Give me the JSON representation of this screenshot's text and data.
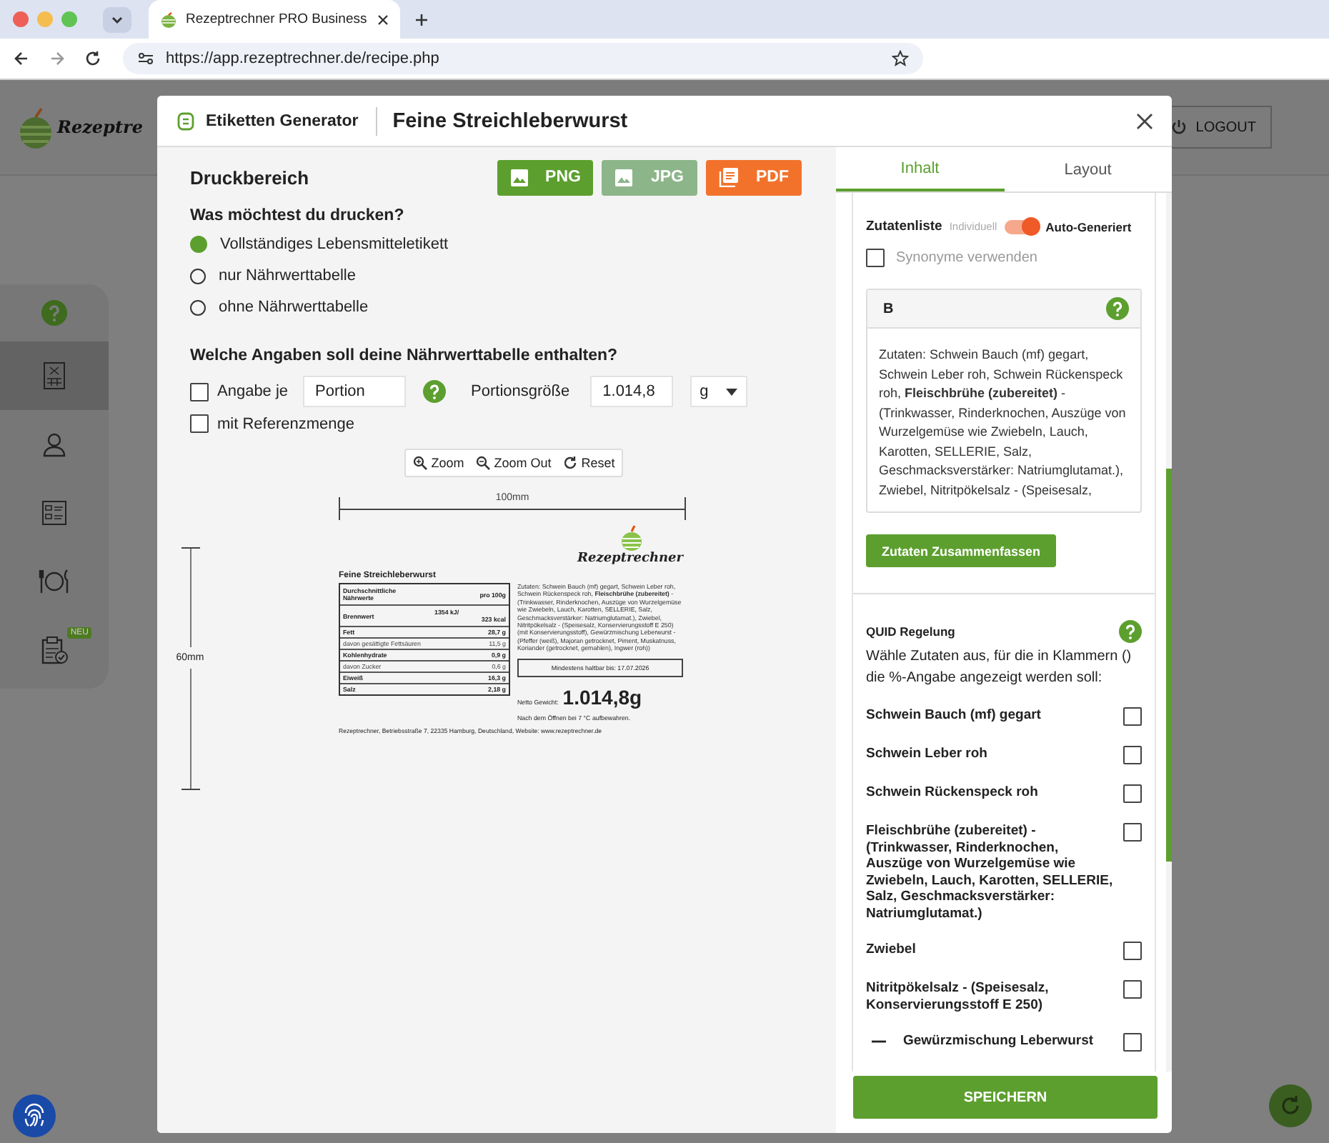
{
  "browser": {
    "tab_title": "Rezeptrechner PRO Business",
    "url": "https://app.rezeptrechner.de/recipe.php"
  },
  "app": {
    "logo_text": "Rezeptre",
    "logout": "LOGOUT",
    "sidebar": [
      {
        "kind": "help",
        "selected": false
      },
      {
        "kind": "recipe",
        "selected": true
      },
      {
        "kind": "user",
        "selected": false
      },
      {
        "kind": "checklist",
        "selected": false
      },
      {
        "kind": "dining",
        "selected": false
      },
      {
        "kind": "clipboard",
        "selected": false,
        "badge": "NEU"
      }
    ]
  },
  "modal": {
    "section": "Etiketten Generator",
    "title": "Feine Streichleberwurst",
    "left": {
      "heading": "Druckbereich",
      "export_buttons": [
        {
          "label": "PNG",
          "kind": "image",
          "color": "#5c9f2e"
        },
        {
          "label": "JPG",
          "kind": "image",
          "color": "#8db58a"
        },
        {
          "label": "PDF",
          "kind": "pdf",
          "color": "#f2722c"
        }
      ],
      "print_question": "Was möchtest du drucken?",
      "print_options": [
        {
          "label": "Vollständiges Lebensmitteletikett",
          "selected": true
        },
        {
          "label": "nur Nährwerttabelle",
          "selected": false
        },
        {
          "label": "ohne Nährwerttabelle",
          "selected": false
        }
      ],
      "table_question": "Welche Angaben soll deine Nährwerttabelle enthalten?",
      "per_unit": {
        "label": "Angabe je",
        "checked": false,
        "value": "Portion"
      },
      "portion_size": {
        "label": "Portionsgröße",
        "value": "1.014,8",
        "unit": "g"
      },
      "reference": {
        "label": "mit Referenzmenge",
        "checked": false
      },
      "zoom_buttons": [
        {
          "label": "Zoom",
          "kind": "zoom-in"
        },
        {
          "label": "Zoom Out",
          "kind": "zoom-out"
        },
        {
          "label": "Reset",
          "kind": "reset"
        }
      ],
      "preview": {
        "width_label": "100mm",
        "height_label": "60mm",
        "product_name": "Feine Streichleberwurst",
        "logo_text": "Rezeptrechner",
        "table_head": [
          "Durchschnittliche Nährwerte",
          "pro 100g"
        ],
        "energy": {
          "name": "Brennwert",
          "values": [
            "1354 kJ/",
            "323 kcal"
          ]
        },
        "rows": [
          {
            "name": "Fett",
            "value": "28,7 g",
            "kind": "main"
          },
          {
            "name": "davon gesättigte Fettsäuren",
            "value": "11,5 g",
            "kind": "sub"
          },
          {
            "name": "Kohlenhydrate",
            "value": "0,9 g",
            "kind": "main"
          },
          {
            "name": "davon Zucker",
            "value": "0,6 g",
            "kind": "sub"
          },
          {
            "name": "Eiweiß",
            "value": "16,3 g",
            "kind": "main"
          },
          {
            "name": "Salz",
            "value": "2,18 g",
            "kind": "main"
          }
        ],
        "ingredients": "Zutaten: Schwein Bauch (mf) gegart, Schwein Leber roh, Schwein Rückenspeck roh, **Fleischbrühe (zubereitet)** - (Trinkwasser, Rinderknochen, Auszüge von Wurzelgemüse wie Zwiebeln, Lauch, Karotten,  SELLERIE, Salz, Geschmacksverstärker: Natriumglutamat.), Zwiebel, Nitritpökelsalz - (Speisesalz, Konservierungsstoff E 250) (mit Konservierungsstoff), Gewürzmischung Leberwurst - (Pfeffer (weiß), Majoran getrocknet, Piment, Muskatnuss, Koriander (getrocknet, gemahlen), Ingwer (roh))",
        "best_before": "Mindestens haltbar bis: 17.07.2026",
        "net_label": "Netto Gewicht:",
        "net_value": "1.014,8g",
        "storage": "Nach dem Öffnen bei 7 °C aufbewahren.",
        "address": "Rezeptrechner, Betriebsstraße 7, 22335 Hamburg, Deutschland, Website: www.rezeptrechner.de"
      }
    },
    "right": {
      "tabs": [
        {
          "label": "Inhalt",
          "selected": true
        },
        {
          "label": "Layout",
          "selected": false
        }
      ],
      "ingredient_list": {
        "label": "Zutatenliste",
        "off_label": "Individuell",
        "on_label": "Auto-Generiert",
        "on": true
      },
      "synonyms": {
        "label": "Synonyme verwenden",
        "checked": false
      },
      "editor": {
        "toolbar": "B",
        "text": "Zutaten: Schwein Bauch (mf) gegart, Schwein Leber roh, Schwein Rückenspeck roh, **Fleischbrühe (zubereitet)** - (Trinkwasser, Rinderknochen, Auszüge von Wurzelgemüse wie Zwiebeln, Lauch, Karotten,  SELLERIE, Salz, Geschmacksverstärker: Natriumglutamat.), Zwiebel, Nitritpökelsalz - (Speisesalz,"
      },
      "merge_button": "Zutaten Zusammenfassen",
      "quid": {
        "title": "QUID Regelung",
        "description": "Wähle Zutaten aus, für die in Klammern () die %-Angabe angezeigt werden soll:",
        "items": [
          {
            "label": "Schwein Bauch (mf) gegart",
            "checked": false,
            "kind": "item"
          },
          {
            "label": "Schwein Leber roh",
            "checked": false,
            "kind": "item"
          },
          {
            "label": "Schwein Rückenspeck roh",
            "checked": false,
            "kind": "item"
          },
          {
            "label": "Fleischbrühe (zubereitet) - (Trinkwasser, Rinderknochen, Auszüge von Wurzelgemüse wie Zwiebeln, Lauch, Karotten,  **SELLERIE**, Salz, Geschmacksverstärker: Natriumglutamat.)",
            "checked": false,
            "kind": "item"
          },
          {
            "label": "Zwiebel",
            "checked": false,
            "kind": "item"
          },
          {
            "label": "Nitritpökelsalz - (Speisesalz, Konservierungsstoff E 250)",
            "checked": false,
            "kind": "item"
          },
          {
            "label": "Gewürzmischung Leberwurst",
            "checked": false,
            "kind": "group",
            "expanded": true
          }
        ]
      },
      "save": "SPEICHERN"
    }
  }
}
